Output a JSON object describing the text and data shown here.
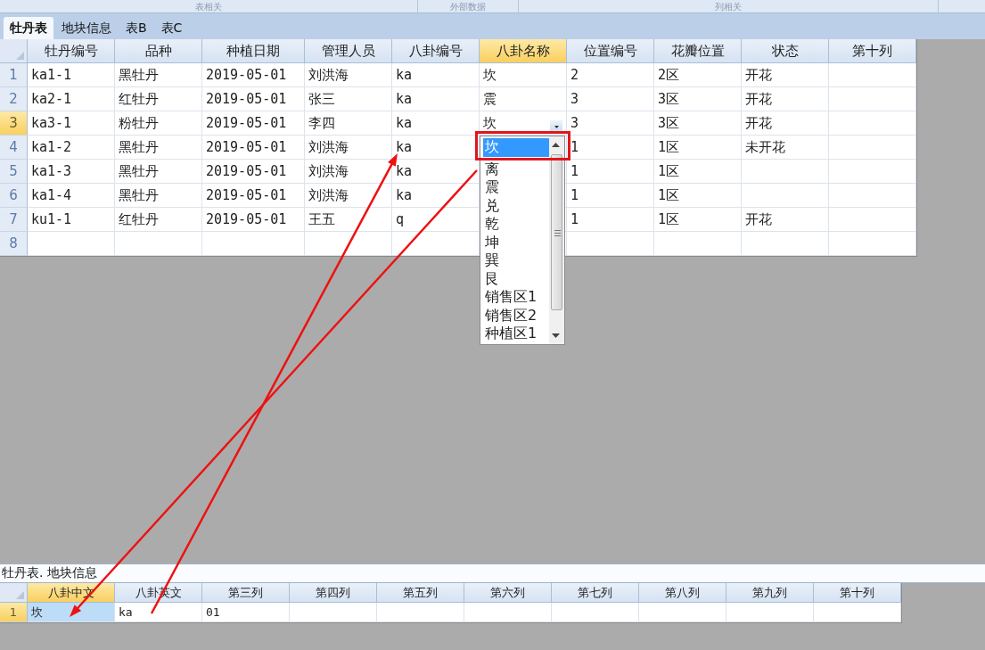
{
  "ribbon_groups": [
    "表相关",
    "外部数据",
    "列相关"
  ],
  "tabs": [
    {
      "label": "牡丹表",
      "selected": true
    },
    {
      "label": "地块信息",
      "selected": false
    },
    {
      "label": "表B",
      "selected": false
    },
    {
      "label": "表C",
      "selected": false
    }
  ],
  "main_grid": {
    "columns": [
      {
        "label": "牡丹编号",
        "selected": false
      },
      {
        "label": "品种",
        "selected": false
      },
      {
        "label": "种植日期",
        "selected": false
      },
      {
        "label": "管理人员",
        "selected": false
      },
      {
        "label": "八卦编号",
        "selected": false
      },
      {
        "label": "八卦名称",
        "selected": true
      },
      {
        "label": "位置编号",
        "selected": false
      },
      {
        "label": "花瓣位置",
        "selected": false
      },
      {
        "label": "状态",
        "selected": false
      },
      {
        "label": "第十列",
        "selected": false
      }
    ],
    "rows": [
      {
        "number": "1",
        "selected": false,
        "cells": [
          "ka1-1",
          "黑牡丹",
          "2019-05-01",
          "刘洪海",
          "ka",
          "坎",
          "2",
          "2区",
          "开花"
        ]
      },
      {
        "number": "2",
        "selected": false,
        "cells": [
          "ka2-1",
          "红牡丹",
          "2019-05-01",
          "张三",
          "ka",
          "震",
          "3",
          "3区",
          "开花"
        ]
      },
      {
        "number": "3",
        "selected": true,
        "cells": [
          "ka3-1",
          "粉牡丹",
          "2019-05-01",
          "李四",
          "ka",
          "坎",
          "3",
          "3区",
          "开花"
        ]
      },
      {
        "number": "4",
        "selected": false,
        "cells": [
          "ka1-2",
          "黑牡丹",
          "2019-05-01",
          "刘洪海",
          "ka",
          "",
          "1",
          "1区",
          "未开花"
        ]
      },
      {
        "number": "5",
        "selected": false,
        "cells": [
          "ka1-3",
          "黑牡丹",
          "2019-05-01",
          "刘洪海",
          "ka",
          "",
          "1",
          "1区"
        ]
      },
      {
        "number": "6",
        "selected": false,
        "cells": [
          "ka1-4",
          "黑牡丹",
          "2019-05-01",
          "刘洪海",
          "ka",
          "",
          "1",
          "1区"
        ]
      },
      {
        "number": "7",
        "selected": false,
        "cells": [
          "ku1-1",
          "红牡丹",
          "2019-05-01",
          "王五",
          "q",
          "",
          "1",
          "1区",
          "开花"
        ]
      },
      {
        "number": "8",
        "selected": false
      }
    ]
  },
  "dropdown": {
    "items": [
      {
        "label": "坎",
        "selected": true
      },
      {
        "label": "离",
        "selected": false
      },
      {
        "label": "震",
        "selected": false
      },
      {
        "label": "兑",
        "selected": false
      },
      {
        "label": "乾",
        "selected": false
      },
      {
        "label": "坤",
        "selected": false
      },
      {
        "label": "巽",
        "selected": false
      },
      {
        "label": "艮",
        "selected": false
      },
      {
        "label": "销售区1",
        "selected": false
      },
      {
        "label": "销售区2",
        "selected": false
      },
      {
        "label": "种植区1",
        "selected": false
      }
    ]
  },
  "bottom_panel": {
    "title": "牡丹表. 地块信息",
    "columns": [
      {
        "label": "八卦中文",
        "selected": true
      },
      {
        "label": "八卦英文",
        "selected": false
      },
      {
        "label": "第三列",
        "selected": false
      },
      {
        "label": "第四列",
        "selected": false
      },
      {
        "label": "第五列",
        "selected": false
      },
      {
        "label": "第六列",
        "selected": false
      },
      {
        "label": "第七列",
        "selected": false
      },
      {
        "label": "第八列",
        "selected": false
      },
      {
        "label": "第九列",
        "selected": false
      },
      {
        "label": "第十列",
        "selected": false
      }
    ],
    "rows": [
      {
        "number": "1",
        "selected": true,
        "cells": [
          "坎",
          "ka",
          "01"
        ]
      }
    ]
  }
}
